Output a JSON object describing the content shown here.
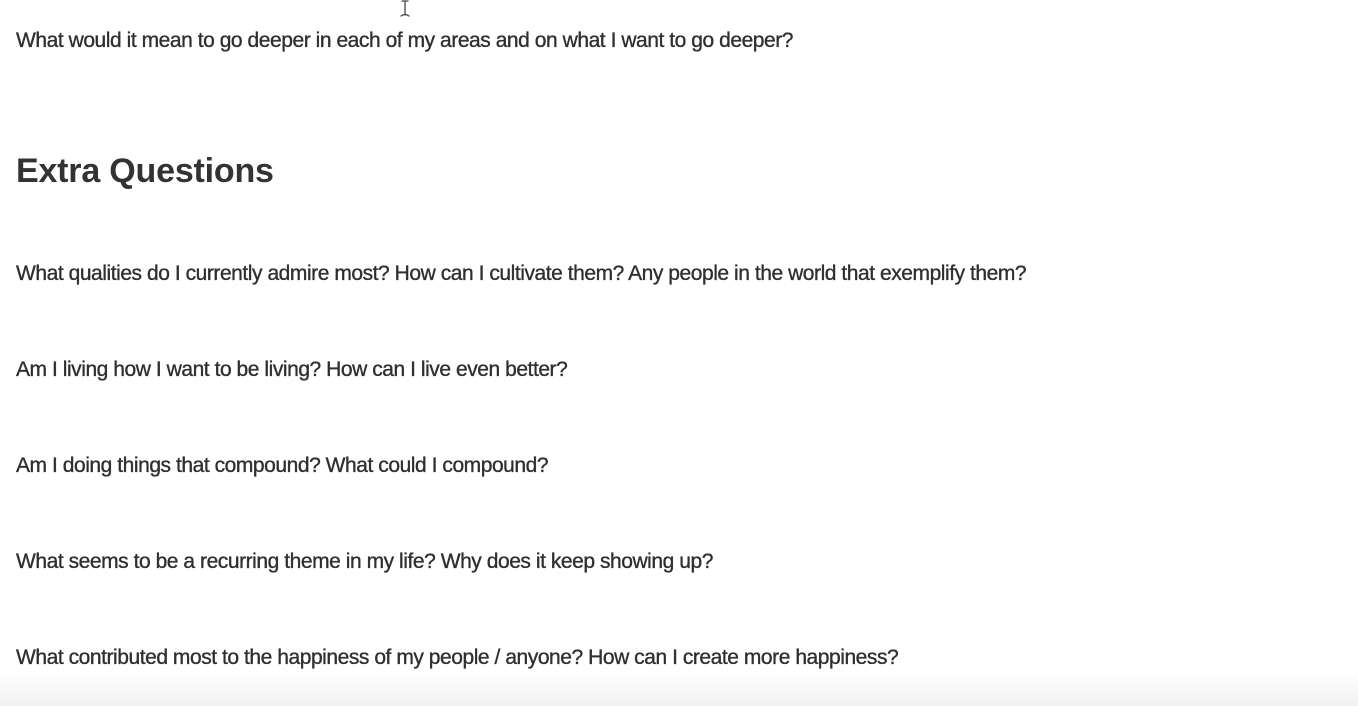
{
  "content": {
    "intro_question": "What would it mean to go deeper in each of my areas and on what I want to go deeper?",
    "section_heading": "Extra Questions",
    "questions": [
      "What qualities do I currently admire most? How can I cultivate them? Any people in the world that exemplify them?",
      "Am I living how I want to be living? How can I live even better?",
      "Am I doing things that compound? What could I compound?",
      "What seems to be a recurring theme in my life? Why does it keep showing up?",
      "What contributed most to the happiness of my people / anyone? How can I create more happiness?"
    ]
  },
  "cursor": {
    "icon": "text-cursor-icon"
  }
}
